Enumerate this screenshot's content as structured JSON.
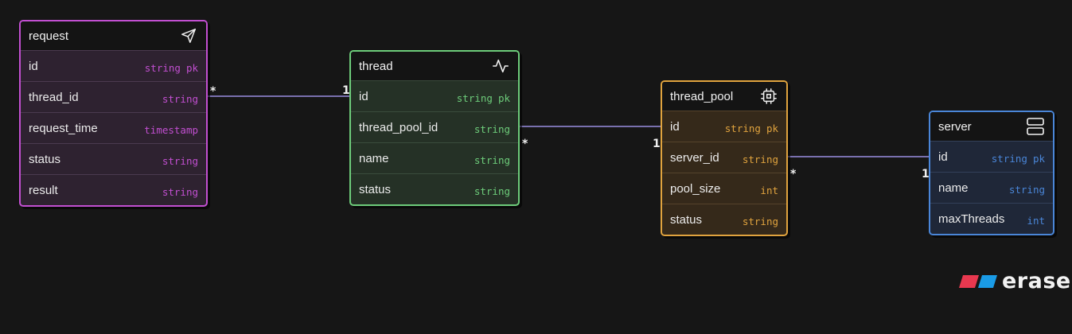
{
  "entities": [
    {
      "name": "request",
      "icon": "send-icon",
      "color": "#c24fd1",
      "fields": [
        {
          "name": "id",
          "type": "string",
          "key": "pk"
        },
        {
          "name": "thread_id",
          "type": "string",
          "key": ""
        },
        {
          "name": "request_time",
          "type": "timestamp",
          "key": ""
        },
        {
          "name": "status",
          "type": "string",
          "key": ""
        },
        {
          "name": "result",
          "type": "string",
          "key": ""
        }
      ]
    },
    {
      "name": "thread",
      "icon": "activity-icon",
      "color": "#6dcc7a",
      "fields": [
        {
          "name": "id",
          "type": "string",
          "key": "pk"
        },
        {
          "name": "thread_pool_id",
          "type": "string",
          "key": ""
        },
        {
          "name": "name",
          "type": "string",
          "key": ""
        },
        {
          "name": "status",
          "type": "string",
          "key": ""
        }
      ]
    },
    {
      "name": "thread_pool",
      "icon": "cpu-icon",
      "color": "#e0a33e",
      "fields": [
        {
          "name": "id",
          "type": "string",
          "key": "pk"
        },
        {
          "name": "server_id",
          "type": "string",
          "key": ""
        },
        {
          "name": "pool_size",
          "type": "int",
          "key": ""
        },
        {
          "name": "status",
          "type": "string",
          "key": ""
        }
      ]
    },
    {
      "name": "server",
      "icon": "server-icon",
      "color": "#4a86d8",
      "fields": [
        {
          "name": "id",
          "type": "string",
          "key": "pk"
        },
        {
          "name": "name",
          "type": "string",
          "key": ""
        },
        {
          "name": "maxThreads",
          "type": "int",
          "key": ""
        }
      ]
    }
  ],
  "relationships": [
    {
      "from": "request.thread_id",
      "to": "thread.id",
      "from_card": "*",
      "to_card": "1"
    },
    {
      "from": "thread.thread_pool_id",
      "to": "thread_pool.id",
      "from_card": "*",
      "to_card": "1"
    },
    {
      "from": "thread_pool.server_id",
      "to": "server.id",
      "from_card": "*",
      "to_card": "1"
    }
  ],
  "connector_color": "#9a8ee0",
  "brand": {
    "name": "eraser",
    "colors": [
      "#e8384f",
      "#1a9be6"
    ]
  }
}
